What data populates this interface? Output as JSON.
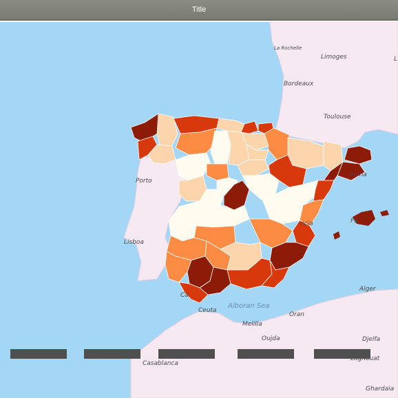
{
  "window": {
    "title": "Title"
  },
  "map": {
    "places": {
      "la_rochelle": "La Rochelle",
      "limoges": "Limoges",
      "bordeaux": "Bordeaux",
      "toulouse": "Toulouse",
      "porto": "Porto",
      "barcelona": "elona",
      "valencia": "ncia",
      "palma": "Pa",
      "lisboa": "Lisboa",
      "alger": "Alger",
      "alboran_sea": "Alboran Sea",
      "ceuta": "Ceuta",
      "cadiz": "Ca",
      "melilla": "Melilla",
      "oran": "Oran",
      "oujda": "Oujda",
      "djelfa": "Djelfa",
      "laghouat": "Laghouat",
      "casablanca": "Casablanca",
      "ghardaia": "Ghardaia",
      "l_edge": "L"
    },
    "colors": {
      "sea": "#a4d6f6",
      "land": "#f6e9f1",
      "c0": "#fffbef",
      "c1": "#fdd5ad",
      "c2": "#fc8c44",
      "c3": "#d8390c",
      "c4": "#8c1b08"
    },
    "legend_bar_count": 5
  }
}
